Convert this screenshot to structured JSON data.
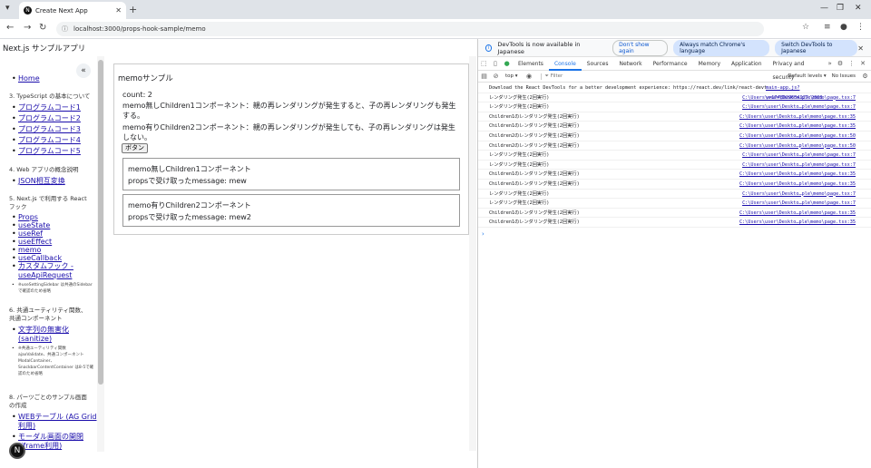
{
  "browser": {
    "tab_title": "Create Next App",
    "url": "localhost:3000/props-hook-sample/memo"
  },
  "app": {
    "title": "Next.js サンプルアプリ"
  },
  "sidebar": {
    "home": "Home",
    "sections": [
      {
        "heading": "3. TypeScript の基本について",
        "links": [
          "プログラムコード1",
          "プログラムコード2",
          "プログラムコード3",
          "プログラムコード4",
          "プログラムコード5"
        ]
      },
      {
        "heading": "4. Web アプリの概念説明",
        "links": [
          "JSON相互変換"
        ]
      },
      {
        "heading": "5. Next.js で利用する React フック",
        "links": [
          "Props",
          "useState",
          "useRef",
          "useEffect",
          "memo",
          "useCallback",
          "カスタムフック - useApiRequest"
        ],
        "note": "※useSettingSidebar は共通のSidebar で確認のため省略"
      },
      {
        "heading": "6. 共通ユーティリティ関数、共通コンポーネント",
        "links": [
          "文字列の無害化 (sanitize)"
        ],
        "note": "※共通ユーティリティ関数 ajaxValidate、共通コンポーネント ModalContainer、SnackbarContentContainer は8-5で確認のため省略"
      },
      {
        "heading": "8. パーツごとのサンプル画面の作成",
        "links": [
          "WEBテーブル (AG Grid利用)",
          "モーダル画面の開閉 (iframe利用)"
        ]
      }
    ]
  },
  "main": {
    "title": "memoサンプル",
    "count": "count: 2",
    "desc1": "memo無しChildren1コンポーネント：親の再レンダリングが発生すると、子の再レンダリングも発生する。",
    "desc2": "memo有りChildren2コンポーネント：親の再レンダリングが発生しても、子の再レンダリングは発生しない。",
    "button": "ボタン",
    "child1": {
      "title": "memo無しChildren1コンポーネント",
      "message": "propsで受け取ったmessage: mew"
    },
    "child2": {
      "title": "memo有りChildren2コンポーネント",
      "message": "propsで受け取ったmessage: mew2"
    }
  },
  "devtools": {
    "info": "DevTools is now available in Japanese",
    "dont_show": "Don't show again",
    "match_lang": "Always match Chrome's language",
    "switch": "Switch DevTools to Japanese",
    "tabs": [
      "Elements",
      "Console",
      "Sources",
      "Network",
      "Performance",
      "Memory",
      "Application",
      "Privacy and security"
    ],
    "context": "top ▾",
    "filter": "Filter",
    "levels": "Default levels ▾",
    "issues": "No Issues",
    "logs": [
      {
        "msg": "Download the React DevTools for a better development experience: https://react.dev/link/react-devtools",
        "src": "main-app.js?v=1748029634927:2303"
      },
      {
        "msg": "レンダリング発生(2回実行)",
        "src": "C:\\Users\\user\\Deskto…ple\\memo\\page.tsx:7"
      },
      {
        "msg": "レンダリング発生(2回実行)",
        "src": "C:\\Users\\user\\Deskto…ple\\memo\\page.tsx:7"
      },
      {
        "msg": "Children1のレンダリング発生(2回実行)",
        "src": "C:\\Users\\user\\Deskto…ple\\memo\\page.tsx:35"
      },
      {
        "msg": "Children1のレンダリング発生(2回実行)",
        "src": "C:\\Users\\user\\Deskto…ple\\memo\\page.tsx:35"
      },
      {
        "msg": "Children2のレンダリング発生(2回実行)",
        "src": "C:\\Users\\user\\Deskto…ple\\memo\\page.tsx:50"
      },
      {
        "msg": "Children2のレンダリング発生(2回実行)",
        "src": "C:\\Users\\user\\Deskto…ple\\memo\\page.tsx:50"
      },
      {
        "msg": "レンダリング発生(2回実行)",
        "src": "C:\\Users\\user\\Deskto…ple\\memo\\page.tsx:7"
      },
      {
        "msg": "レンダリング発生(2回実行)",
        "src": "C:\\Users\\user\\Deskto…ple\\memo\\page.tsx:7"
      },
      {
        "msg": "Children1のレンダリング発生(2回実行)",
        "src": "C:\\Users\\user\\Deskto…ple\\memo\\page.tsx:35"
      },
      {
        "msg": "Children1のレンダリング発生(2回実行)",
        "src": "C:\\Users\\user\\Deskto…ple\\memo\\page.tsx:35"
      },
      {
        "msg": "レンダリング発生(2回実行)",
        "src": "C:\\Users\\user\\Deskto…ple\\memo\\page.tsx:7"
      },
      {
        "msg": "レンダリング発生(2回実行)",
        "src": "C:\\Users\\user\\Deskto…ple\\memo\\page.tsx:7"
      },
      {
        "msg": "Children1のレンダリング発生(2回実行)",
        "src": "C:\\Users\\user\\Deskto…ple\\memo\\page.tsx:35"
      },
      {
        "msg": "Children1のレンダリング発生(2回実行)",
        "src": "C:\\Users\\user\\Deskto…ple\\memo\\page.tsx:35"
      }
    ]
  }
}
